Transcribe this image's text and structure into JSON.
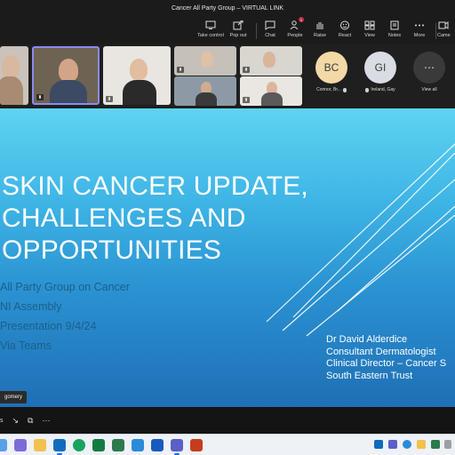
{
  "window": {
    "title": "Cancer All Party Group – VIRTUAL LINK"
  },
  "toolbar": {
    "items": [
      {
        "id": "take-control",
        "label": "Take control",
        "icon": "take-control-icon"
      },
      {
        "id": "pop-out",
        "label": "Pop out",
        "icon": "pop-out-icon"
      },
      {
        "id": "chat",
        "label": "Chat",
        "icon": "chat-icon"
      },
      {
        "id": "people",
        "label": "People",
        "icon": "people-icon",
        "badge": "1"
      },
      {
        "id": "raise",
        "label": "Raise",
        "icon": "raise-hand-icon"
      },
      {
        "id": "react",
        "label": "React",
        "icon": "react-icon"
      },
      {
        "id": "view",
        "label": "View",
        "icon": "view-icon"
      },
      {
        "id": "notes",
        "label": "Notes",
        "icon": "notes-icon"
      },
      {
        "id": "more",
        "label": "More",
        "icon": "more-icon"
      },
      {
        "id": "camera",
        "label": "Came",
        "icon": "camera-icon"
      }
    ]
  },
  "participants": {
    "avatars": [
      {
        "initials": "BC",
        "name": "Connor, Br...",
        "color": "#f3d9a6"
      },
      {
        "initials": "GI",
        "name": "Ireland, Gay",
        "color": "#d9dde3"
      }
    ],
    "view_all_label": "View all",
    "view_all_icon": "ellipsis"
  },
  "slide": {
    "title_lines": [
      "SKIN CANCER UPDATE,",
      "CHALLENGES AND",
      "OPPORTUNITIES"
    ],
    "detail_lines": [
      "All Party Group on Cancer",
      "NI Assembly",
      "Presentation 9/4/24",
      "Via Teams"
    ],
    "presenter_lines": [
      "Dr David Alderdice",
      "Consultant Dermatologist",
      "Clinical Director – Cancer S",
      "South Eastern Trust"
    ],
    "speaker_tag": "gomery"
  },
  "bottombar": {
    "text": "s"
  },
  "colors": {
    "accent": "#6264a7",
    "slide_top": "#5fd3f1",
    "slide_bottom": "#1f6fb5",
    "badge": "#c4314b"
  }
}
